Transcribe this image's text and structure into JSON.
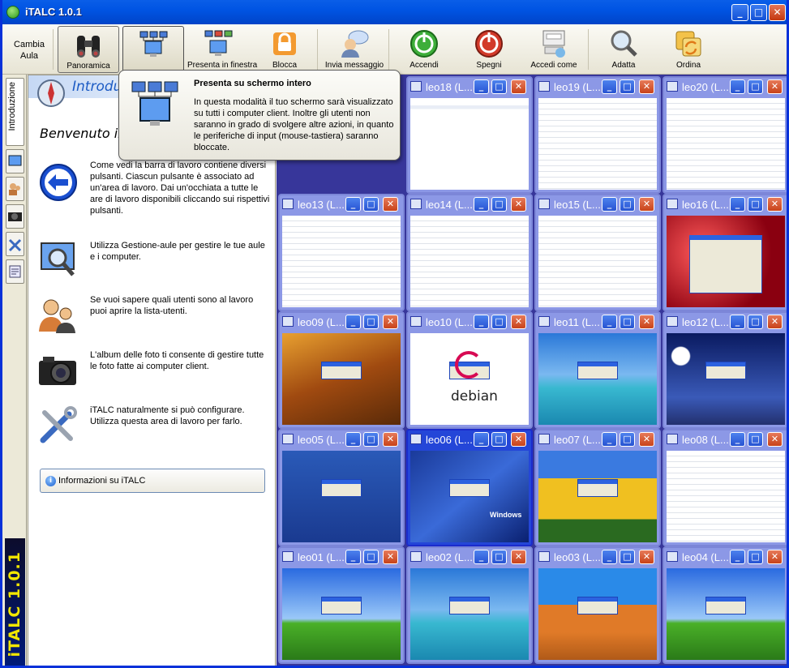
{
  "window": {
    "title": "iTALC 1.0.1",
    "brand": "iTALC 1.0.1"
  },
  "toolbar": {
    "cambia_aula": "Cambia Aula",
    "buttons": [
      {
        "label": "Panoramica",
        "icon": "binoculars-icon"
      },
      {
        "label": "",
        "icon": "fullscreen-demo-icon"
      },
      {
        "label": "Presenta in finestra",
        "icon": "window-demo-icon"
      },
      {
        "label": "Blocca",
        "icon": "lock-icon"
      },
      {
        "label": "Invia messaggio",
        "icon": "message-icon"
      },
      {
        "label": "Accendi",
        "icon": "power-on-icon"
      },
      {
        "label": "Spegni",
        "icon": "power-off-icon"
      },
      {
        "label": "Accedi come",
        "icon": "logon-icon"
      },
      {
        "label": "Adatta",
        "icon": "magnifier-icon"
      },
      {
        "label": "Ordina",
        "icon": "arrange-icon"
      }
    ]
  },
  "side_tabs": {
    "introduzione": "Introduzione"
  },
  "panel": {
    "title": "Introdu",
    "welcome": "Benvenuto in",
    "items": [
      {
        "icon": "back-arrow-icon",
        "text": "Come vedi la barra di lavoro contiene diversi pulsanti. Ciascun pulsante è associato ad un'area di lavoro. Dai un'occhiata a tutte le are di lavoro disponibili cliccando sui rispettivi pulsanti."
      },
      {
        "icon": "classroom-manager-icon",
        "text": "Utilizza Gestione-aule per gestire le tue aule e i computer."
      },
      {
        "icon": "users-icon",
        "text": "Se vuoi sapere quali utenti sono al lavoro puoi aprire la lista-utenti."
      },
      {
        "icon": "camera-icon",
        "text": "L'album delle foto ti consente di gestire tutte le foto fatte ai computer client."
      },
      {
        "icon": "tools-icon",
        "text": "iTALC naturalmente si può configurare. Utilizza questa area di lavoro per farlo."
      }
    ],
    "info_button": "Informazioni su iTALC"
  },
  "tooltip": {
    "title": "Presenta su schermo intero",
    "text": "In questa modalità il tuo schermo sarà visualizzato su tutti i computer client. Inoltre gli utenti non saranno in grado di svolgere altre azioni, in quanto le periferiche di input (mouse-tastiera) saranno bloccate."
  },
  "clients": [
    {
      "name": "leo18 (L...",
      "screen": "spreadsheet-dialog"
    },
    {
      "name": "leo19 (L...",
      "screen": "spreadsheet"
    },
    {
      "name": "leo20 (L...",
      "screen": "spreadsheet"
    },
    {
      "name": "leo13 (L...",
      "screen": "spreadsheet-chart"
    },
    {
      "name": "leo14 (L...",
      "screen": "spreadsheet-table"
    },
    {
      "name": "leo15 (L...",
      "screen": "spreadsheet-menu"
    },
    {
      "name": "leo16 (L...",
      "screen": "desktop-red-explorer"
    },
    {
      "name": "leo09 (L...",
      "screen": "desktop-autumn"
    },
    {
      "name": "leo10 (L...",
      "screen": "desktop-debian",
      "caption": "debian"
    },
    {
      "name": "leo11 (L...",
      "screen": "desktop-beach"
    },
    {
      "name": "leo12 (L...",
      "screen": "desktop-moon"
    },
    {
      "name": "leo05 (L...",
      "screen": "desktop-fish"
    },
    {
      "name": "leo06 (L...",
      "screen": "desktop-xp-blue",
      "caption": "Windows"
    },
    {
      "name": "leo07 (L...",
      "screen": "desktop-tulips"
    },
    {
      "name": "leo08 (L...",
      "screen": "spreadsheet-small"
    },
    {
      "name": "leo01 (L...",
      "screen": "desktop-bliss"
    },
    {
      "name": "leo02 (L...",
      "screen": "desktop-beach"
    },
    {
      "name": "leo03 (L...",
      "screen": "desktop-dune"
    },
    {
      "name": "leo04 (L...",
      "screen": "desktop-bliss"
    }
  ],
  "selected_client": "leo06 (L...",
  "colors": {
    "titlebar": "#0054e3",
    "grid_bg": "#37369a",
    "tile": "#8c98e6",
    "selected_tile": "#2446d8",
    "brand": "#f2e600"
  }
}
